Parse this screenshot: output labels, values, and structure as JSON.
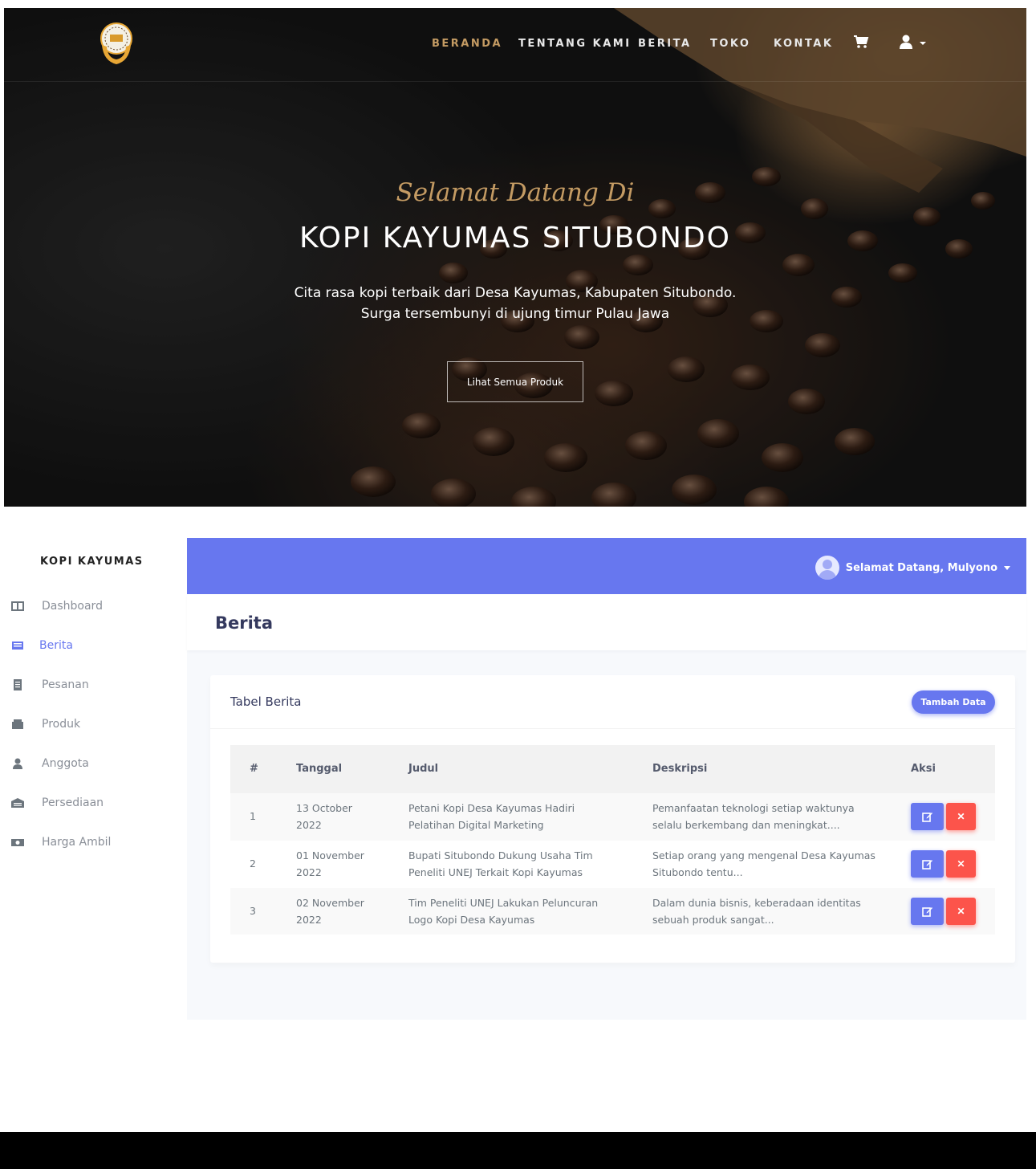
{
  "hero": {
    "nav": [
      "BERANDA",
      "TENTANG KAMI",
      "BERITA",
      "TOKO",
      "KONTAK"
    ],
    "active_nav": "BERANDA",
    "script_title": "Selamat Datang Di",
    "title": "KOPI KAYUMAS SITUBONDO",
    "subtitle_line1": "Cita rasa kopi terbaik dari Desa Kayumas, Kabupaten Situbondo.",
    "subtitle_line2": "Surga tersembunyi di ujung timur Pulau Jawa",
    "button": "Lihat Semua Produk",
    "icons": [
      "logo",
      "cart-icon",
      "user-icon",
      "caret-down-icon"
    ],
    "accent_color": "#c49b63"
  },
  "admin": {
    "brand": "KOPI KAYUMAS",
    "sidebar": [
      {
        "label": "Dashboard",
        "icon": "columns-icon"
      },
      {
        "label": "Berita",
        "icon": "newspaper-icon",
        "active": true
      },
      {
        "label": "Pesanan",
        "icon": "document-icon"
      },
      {
        "label": "Produk",
        "icon": "box-icon"
      },
      {
        "label": "Anggota",
        "icon": "user-icon"
      },
      {
        "label": "Persediaan",
        "icon": "warehouse-icon"
      },
      {
        "label": "Harga Ambil",
        "icon": "money-icon"
      }
    ],
    "user_greeting": "Selamat Datang, Mulyono",
    "page_title": "Berita",
    "card_title": "Tabel Berita",
    "add_button": "Tambah Data",
    "table": {
      "headers": [
        "#",
        "Tanggal",
        "Judul",
        "Deskripsi",
        "Aksi"
      ],
      "rows": [
        {
          "no": "1",
          "date1": "13 October",
          "date2": "2022",
          "title1": "Petani Kopi Desa Kayumas Hadiri",
          "title2": "Pelatihan Digital Marketing",
          "desc1": "Pemanfaatan teknologi setiap waktunya",
          "desc2": "selalu berkembang dan meningkat...."
        },
        {
          "no": "2",
          "date1": "01 November",
          "date2": "2022",
          "title1": "Bupati Situbondo Dukung Usaha Tim",
          "title2": "Peneliti UNEJ Terkait Kopi Kayumas",
          "desc1": "Setiap orang yang mengenal Desa Kayumas",
          "desc2": "Situbondo tentu..."
        },
        {
          "no": "3",
          "date1": "02 November",
          "date2": "2022",
          "title1": "Tim Peneliti UNEJ Lakukan Peluncuran",
          "title2": "Logo Kopi Desa Kayumas",
          "desc1": "Dalam dunia bisnis, keberadaan identitas",
          "desc2": "sebuah produk sangat..."
        }
      ]
    },
    "primary_color": "#6777ef",
    "danger_color": "#fc544b"
  }
}
